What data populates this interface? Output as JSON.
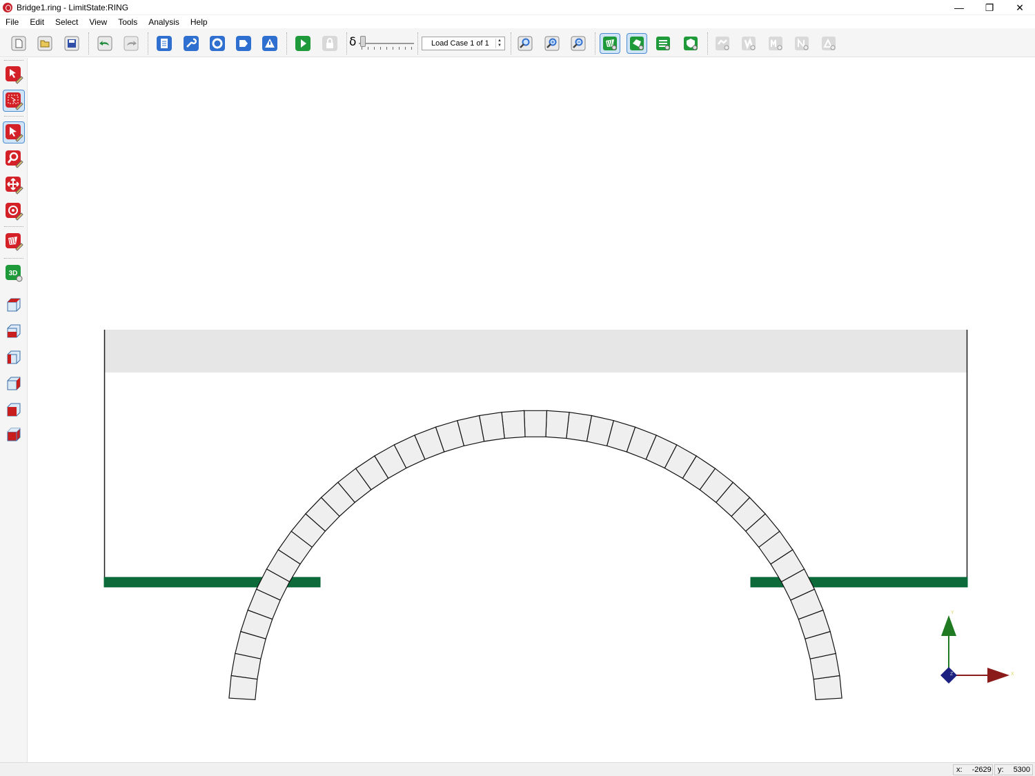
{
  "window": {
    "title": "Bridge1.ring - LimitState:RING",
    "minimize": "—",
    "restore": "❐",
    "close": "✕"
  },
  "menu": [
    "File",
    "Edit",
    "Select",
    "View",
    "Tools",
    "Analysis",
    "Help"
  ],
  "toolbar": {
    "delta_symbol": "δ",
    "load_case": "Load Case 1 of 1",
    "spin_up": "▲",
    "spin_down": "▼"
  },
  "axes": {
    "y_label": "Y",
    "x_label": "X",
    "z_label": "Z"
  },
  "colors": {
    "accent_red": "#d42027",
    "accent_green": "#1f9a3a",
    "accent_blue": "#2f6fcf",
    "ground_green": "#0d6a3a",
    "fill_grey": "#e6e6e6",
    "axis_x": "#8b1a1a",
    "axis_y": "#1f7a22",
    "axis_z": "#1c2080"
  },
  "status": {
    "x_label": "x:",
    "x_value": "-2629",
    "y_label": "y:",
    "y_value": "5300"
  }
}
